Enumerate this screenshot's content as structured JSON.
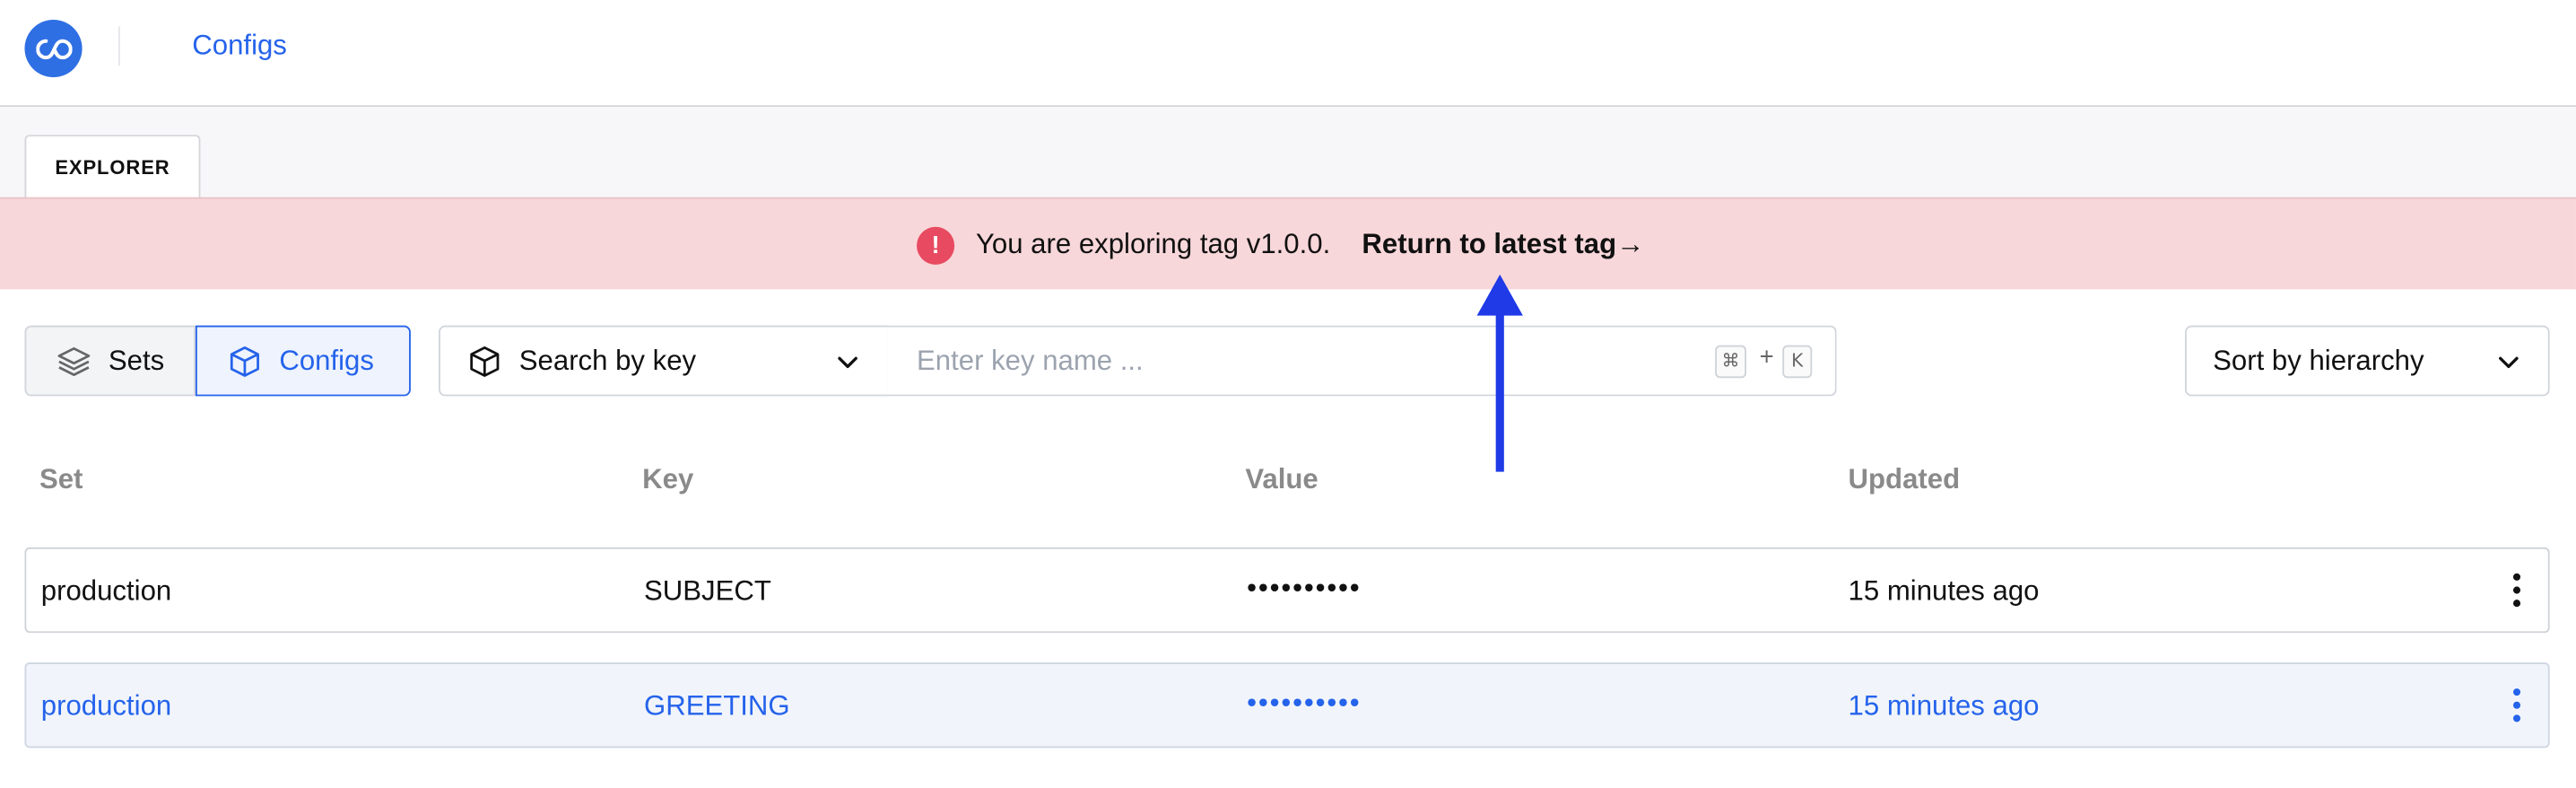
{
  "header": {
    "logo_icon": "infinity-logo-icon",
    "breadcrumb": "Configs"
  },
  "tabs": [
    {
      "label": "EXPLORER",
      "active": true
    }
  ],
  "banner": {
    "icon": "exclamation-icon",
    "text": "You are exploring tag v1.0.0.",
    "link": "Return to latest tag",
    "link_arrow": "→",
    "background": "#f8d7da",
    "icon_color": "#e84b61"
  },
  "toolbar": {
    "toggle": [
      {
        "label": "Sets",
        "icon": "layers-icon",
        "selected": false
      },
      {
        "label": "Configs",
        "icon": "cube-icon",
        "selected": true
      }
    ],
    "search_mode": {
      "label": "Search by key",
      "icon": "cube-icon"
    },
    "search": {
      "placeholder": "Enter key name ...",
      "value": ""
    },
    "shortcut": {
      "key1": "⌘",
      "plus": "+",
      "key2": "K"
    },
    "sort": {
      "label": "Sort by hierarchy"
    }
  },
  "table": {
    "columns": [
      "Set",
      "Key",
      "Value",
      "Updated"
    ],
    "rows": [
      {
        "set": "production",
        "key": "SUBJECT",
        "value": "••••••••••",
        "updated": "15 minutes ago",
        "selected": false
      },
      {
        "set": "production",
        "key": "GREETING",
        "value": "••••••••••",
        "updated": "15 minutes ago",
        "selected": true
      }
    ]
  },
  "colors": {
    "accent": "#2563eb",
    "annotation": "#1f3ae6"
  }
}
